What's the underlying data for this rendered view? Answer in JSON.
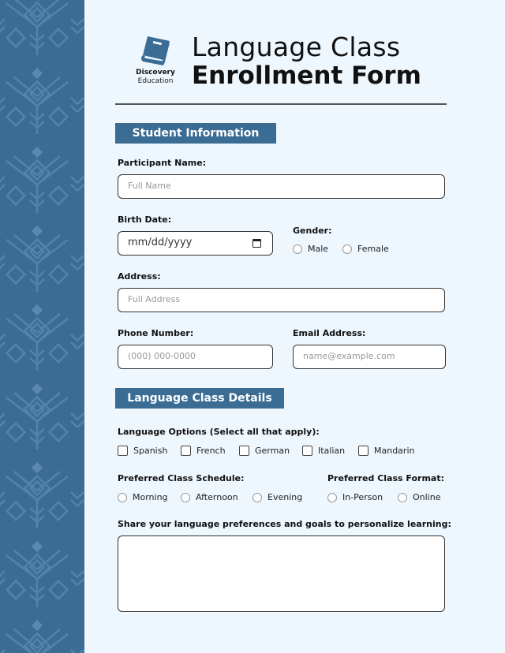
{
  "logo": {
    "icon": "book-icon",
    "line1": "Discovery",
    "line2": "Education"
  },
  "header": {
    "title_line1": "Language Class",
    "title_line2": "Enrollment Form"
  },
  "sections": {
    "student": "Student Information",
    "language": "Language Class Details"
  },
  "student": {
    "name_label": "Participant Name:",
    "name_placeholder": "Full Name",
    "birth_label": "Birth Date:",
    "birth_placeholder": "mm/dd/yyyy",
    "gender_label": "Gender:",
    "gender_options": [
      "Male",
      "Female"
    ],
    "address_label": "Address:",
    "address_placeholder": "Full Address",
    "phone_label": "Phone Number:",
    "phone_placeholder": "(000) 000-0000",
    "email_label": "Email Address:",
    "email_placeholder": "name@example.com"
  },
  "language": {
    "options_label": "Language Options (Select all that apply):",
    "options": [
      "Spanish",
      "French",
      "German",
      "Italian",
      "Mandarin"
    ],
    "schedule_label": "Preferred Class Schedule:",
    "schedule_options": [
      "Morning",
      "Afternoon",
      "Evening"
    ],
    "format_label": "Preferred Class Format:",
    "format_options": [
      "In-Person",
      "Online"
    ],
    "goals_label": "Share your language preferences and goals to personalize learning:",
    "goals_value": ""
  },
  "colors": {
    "accent": "#3b6c94",
    "background": "#eef7fe"
  }
}
